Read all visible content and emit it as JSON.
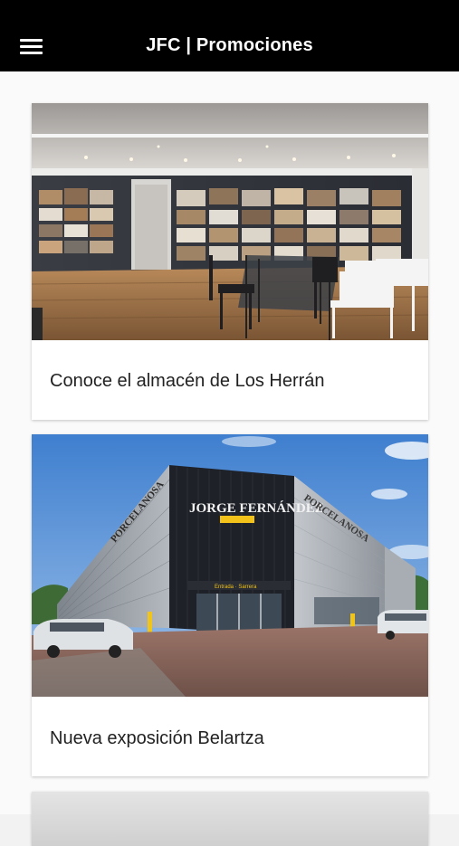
{
  "header": {
    "title": "JFC | Promociones",
    "menu_icon": "hamburger-menu-icon"
  },
  "promotions": [
    {
      "title": "Conoce el almacén de Los Herrán"
    },
    {
      "title": "Nueva exposición Belartza",
      "building_sign": "JORGE FERNÁNDEZ",
      "facade_text": "PORCELANOSA",
      "entrance_sign": "Entrada · Sarrera"
    }
  ]
}
